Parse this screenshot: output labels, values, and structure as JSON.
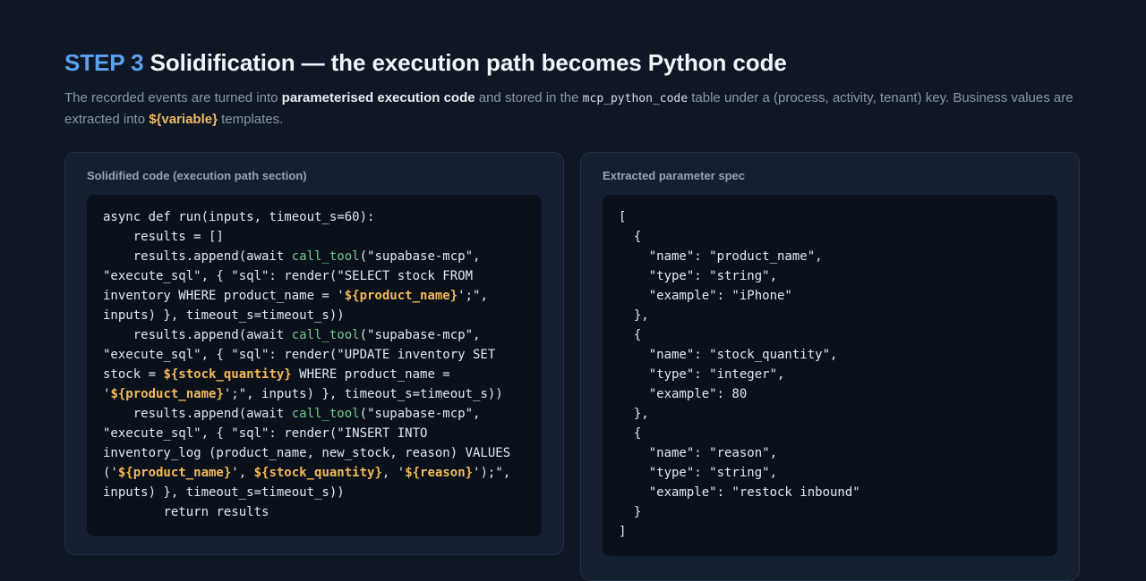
{
  "heading": {
    "step": "STEP 3",
    "title": "Solidification — the execution path becomes Python code"
  },
  "description": {
    "part1": "The recorded events are turned into ",
    "bold": "parameterised execution code",
    "part2": " and stored in the ",
    "code": "mcp_python_code",
    "part3": " table under a (process, activity, tenant) key. Business values are extracted into ",
    "variable": "${variable}",
    "part4": " templates."
  },
  "left_panel": {
    "title": "Solidified code (execution path section)",
    "segments": [
      {
        "t": "async def run(inputs, timeout_s=60):\n    results = []\n    results.append(await "
      },
      {
        "t": "call_tool",
        "c": "fn"
      },
      {
        "t": "(\"supabase-mcp\",\n\"execute_sql\", { \"sql\": render(\"SELECT stock FROM\ninventory WHERE product_name = '"
      },
      {
        "t": "${product_name}",
        "c": "tv"
      },
      {
        "t": "';\",\ninputs) }, timeout_s=timeout_s))\n    results.append(await "
      },
      {
        "t": "call_tool",
        "c": "fn"
      },
      {
        "t": "(\"supabase-mcp\",\n\"execute_sql\", { \"sql\": render(\"UPDATE inventory SET\nstock = "
      },
      {
        "t": "${stock_quantity}",
        "c": "tv"
      },
      {
        "t": " WHERE product_name =\n'"
      },
      {
        "t": "${product_name}",
        "c": "tv"
      },
      {
        "t": "';\", inputs) }, timeout_s=timeout_s))\n    results.append(await "
      },
      {
        "t": "call_tool",
        "c": "fn"
      },
      {
        "t": "(\"supabase-mcp\",\n\"execute_sql\", { \"sql\": render(\"INSERT INTO\ninventory_log (product_name, new_stock, reason) VALUES\n('"
      },
      {
        "t": "${product_name}",
        "c": "tv"
      },
      {
        "t": "', "
      },
      {
        "t": "${stock_quantity}",
        "c": "tv"
      },
      {
        "t": ", '"
      },
      {
        "t": "${reason}",
        "c": "tv"
      },
      {
        "t": "');\",\ninputs) }, timeout_s=timeout_s))\n        return results"
      }
    ]
  },
  "right_panel": {
    "title": "Extracted parameter spec",
    "code": "[\n  {\n    \"name\": \"product_name\",\n    \"type\": \"string\",\n    \"example\": \"iPhone\"\n  },\n  {\n    \"name\": \"stock_quantity\",\n    \"type\": \"integer\",\n    \"example\": 80\n  },\n  {\n    \"name\": \"reason\",\n    \"type\": \"string\",\n    \"example\": \"restock inbound\"\n  }\n]"
  }
}
